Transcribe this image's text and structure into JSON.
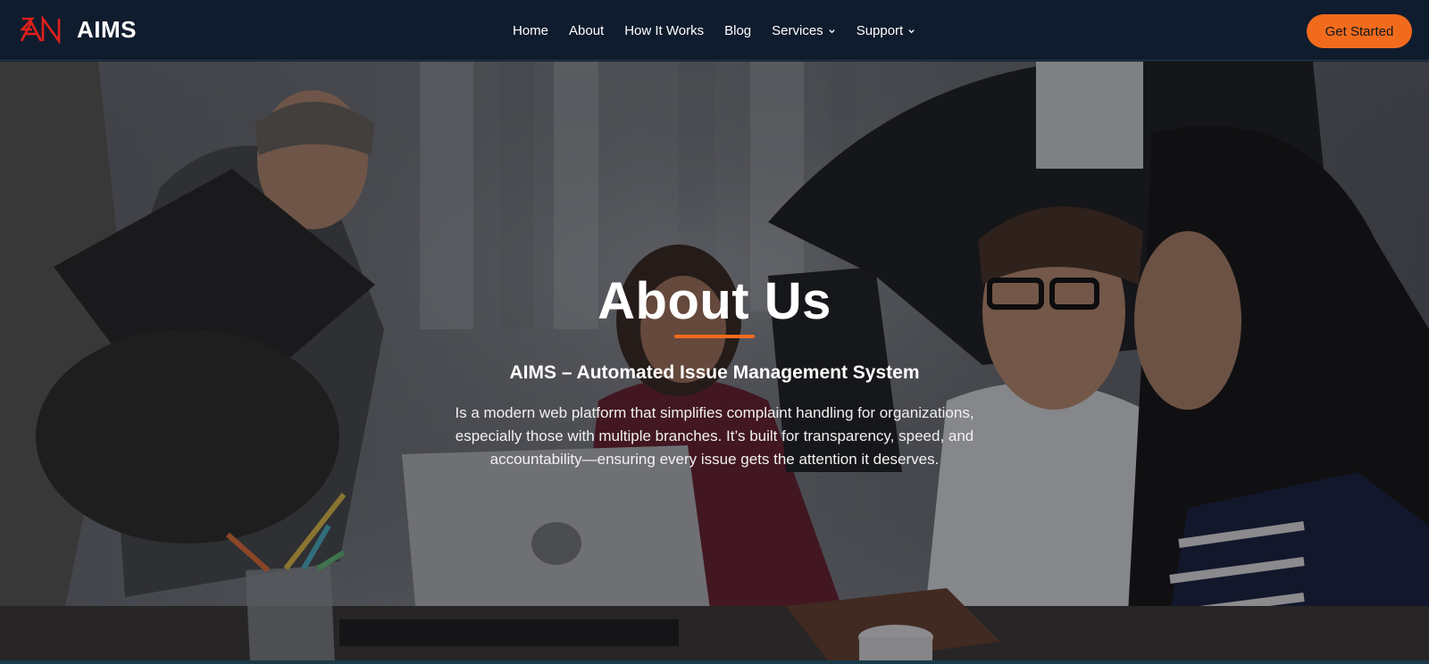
{
  "brand": {
    "name": "AIMS",
    "logo_icon": "aims-logo-icon",
    "logo_color": "#e0201b"
  },
  "nav": {
    "items": [
      {
        "label": "Home"
      },
      {
        "label": "About"
      },
      {
        "label": "How It Works"
      },
      {
        "label": "Blog"
      },
      {
        "label": "Services",
        "dropdown": true
      },
      {
        "label": "Support",
        "dropdown": true
      }
    ],
    "cta_label": "Get Started"
  },
  "hero": {
    "title": "About Us",
    "subtitle": "AIMS – Automated Issue Management System",
    "description": "Is a modern web platform that simplifies complaint handling for organizations, especially those with multiple branches. It’s built for transparency, speed, and accountability—ensuring every issue gets the attention it deserves.",
    "background_image": "office-team-meeting-photo"
  },
  "colors": {
    "navbar_bg": "#0f1c2e",
    "accent": "#f26b1d",
    "text": "#ffffff"
  }
}
